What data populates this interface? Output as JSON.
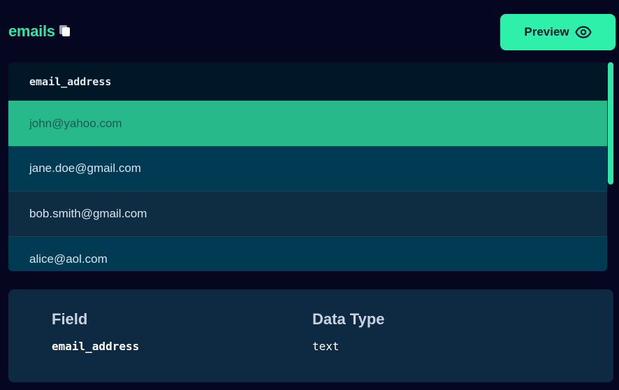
{
  "header": {
    "title": "emails",
    "preview_label": "Preview"
  },
  "table": {
    "column": "email_address",
    "rows": [
      {
        "value": "john@yahoo.com",
        "selected": true
      },
      {
        "value": "jane.doe@gmail.com"
      },
      {
        "value": "bob.smith@gmail.com"
      },
      {
        "value": "alice@aol.com"
      }
    ]
  },
  "schema": {
    "field_header": "Field",
    "type_header": "Data Type",
    "field_value": "email_address",
    "type_value": "text"
  },
  "colors": {
    "accent": "#2ee6a6",
    "selected_row": "#27b98a",
    "background": "#05061f",
    "panel": "#0e2a42"
  },
  "icons": {
    "copy": "copy-icon",
    "preview": "eye-icon"
  }
}
